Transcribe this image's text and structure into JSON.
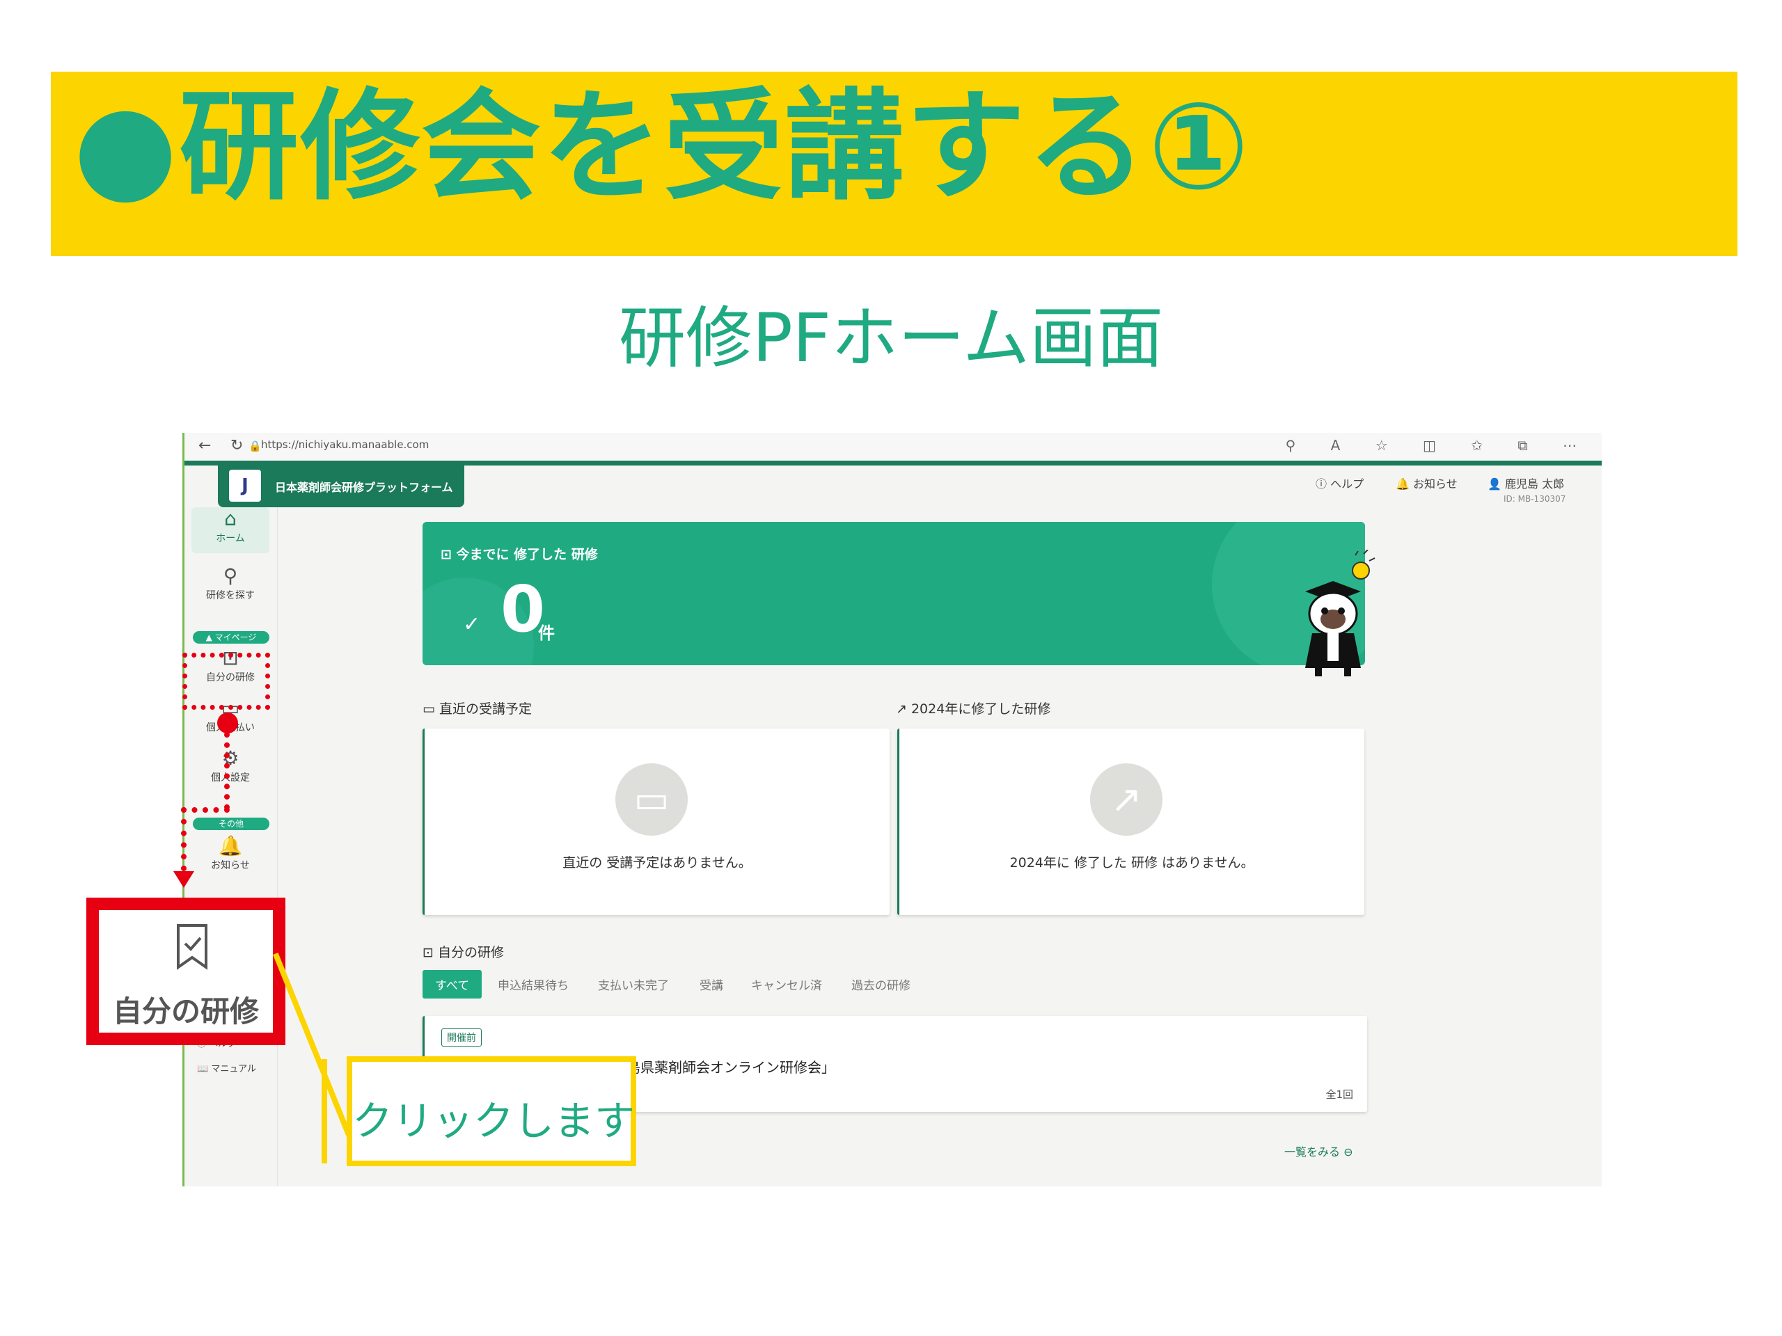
{
  "banner": {
    "title": "●研修会を受講する①"
  },
  "subtitle": "研修PFホーム画面",
  "browser": {
    "url": "https://nichiyaku.manaable.com"
  },
  "app": {
    "brand_name": "日本薬剤師会研修プラットフォーム",
    "logo_letter": "J",
    "header": {
      "help": "ヘルプ",
      "notifications": "お知らせ",
      "user_name": "鹿児島 太郎",
      "user_id": "ID: MB-130307"
    },
    "sidebar": {
      "home": "ホーム",
      "search": "研修を探す",
      "mypage_pill": "▲ マイページ",
      "my_training": "自分の研修",
      "payment": "個人支払い",
      "settings": "個人設定",
      "other_pill": "その他",
      "notifications": "お知らせ",
      "help": "ヘルプ",
      "manual": "マニュアル"
    },
    "hero": {
      "label": "今までに 修了した 研修",
      "count": "0",
      "unit": "件"
    },
    "upcoming": {
      "title": "直近の受講予定",
      "empty": "直近の 受講予定はありません。"
    },
    "completed": {
      "title": "2024年に修了した研修",
      "empty": "2024年に 修了した 研修 はありません。"
    },
    "my_training": {
      "title": "自分の研修",
      "tabs": [
        "すべて",
        "申込結果待ち",
        "支払い未完了",
        "受講",
        "キャンセル済",
        "過去の研修"
      ],
      "course": {
        "badge": "開催前",
        "title": "鹿児島県薬剤師会オンライン研修会」",
        "count": "全1回"
      },
      "see_all": "一覧をみる ⊖"
    }
  },
  "annotation": {
    "zoom_label": "自分の研修",
    "callout": "クリックします"
  },
  "colors": {
    "accent": "#1faa82",
    "dark_green": "#1b7a5a",
    "yellow": "#fcd400",
    "red": "#e60012"
  }
}
